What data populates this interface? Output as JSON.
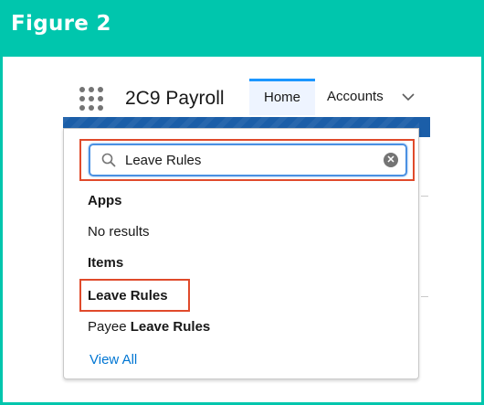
{
  "figure_label": "Figure 2",
  "nav": {
    "app_name": "2C9 Payroll",
    "tabs": [
      {
        "label": "Home"
      },
      {
        "label": "Accounts"
      }
    ]
  },
  "search": {
    "value": "Leave Rules"
  },
  "dropdown": {
    "apps_heading": "Apps",
    "apps_empty": "No results",
    "items_heading": "Items",
    "items": [
      {
        "prefix": "",
        "match": "Leave Rules"
      },
      {
        "prefix": "Payee ",
        "match": "Leave Rules"
      }
    ],
    "view_all": "View All"
  },
  "colors": {
    "frame": "#00c6ad",
    "highlight": "#e04a2b",
    "link": "#0176d3",
    "focus": "#4a90e2",
    "banner": "#1b5ea8"
  },
  "icons": [
    "app-launcher-icon",
    "chevron-down-icon",
    "search-icon",
    "clear-icon"
  ]
}
